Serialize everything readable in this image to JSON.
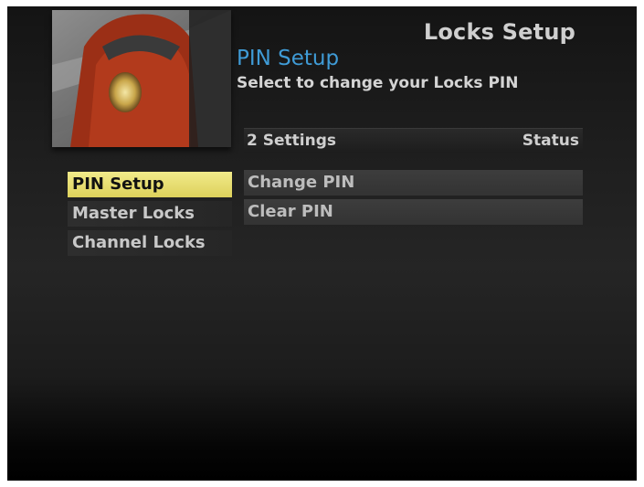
{
  "header": {
    "page_title": "Locks Setup",
    "section_title": "PIN Setup",
    "section_description": "Select to change your Locks PIN"
  },
  "preview": {
    "icon": "live-tv-preview-motorcycle"
  },
  "settings_list": {
    "count_label": "2 Settings",
    "status_label": "Status",
    "items": [
      {
        "label": "Change PIN"
      },
      {
        "label": "Clear PIN"
      }
    ]
  },
  "left_menu": {
    "items": [
      {
        "label": "PIN Setup",
        "selected": true
      },
      {
        "label": "Master Locks",
        "selected": false
      },
      {
        "label": "Channel Locks",
        "selected": false
      }
    ]
  },
  "colors": {
    "accent_blue": "#3f9bd6",
    "highlight_yellow": "#e8df70",
    "background_dark": "#1e1e1e",
    "text_light": "#d4d4d4"
  }
}
